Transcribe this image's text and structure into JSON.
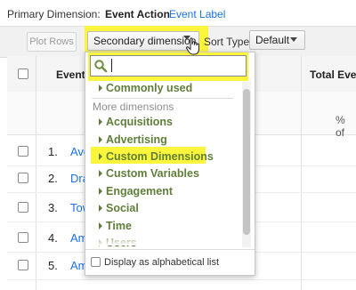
{
  "header": {
    "primary_label": "Primary Dimension:",
    "primary_active": "Event Action",
    "primary_other": "Event Label"
  },
  "toolbar": {
    "plot_rows": "Plot Rows",
    "secondary_dimension": "Secondary dimension",
    "sort_label": "Sort Type:",
    "sort_value": "Default"
  },
  "table": {
    "col_event": "Event A",
    "col_total": "Total Event",
    "percent_text": "% of",
    "rows": [
      {
        "num": "1.",
        "label": "Ave"
      },
      {
        "num": "2.",
        "label": "Dra"
      },
      {
        "num": "3.",
        "label": "Tow"
      },
      {
        "num": "4.",
        "label": "Am"
      },
      {
        "num": "5.",
        "label": "Am"
      }
    ]
  },
  "dropdown": {
    "search_value": "",
    "commonly_used": "Commonly used",
    "more_label": "More dimensions",
    "items": [
      "Acquisitions",
      "Advertising",
      "Custom Dimensions",
      "Custom Variables",
      "Engagement",
      "Social",
      "Time",
      "Users"
    ],
    "alphabetical": "Display as alphabetical list"
  },
  "colors": {
    "highlight": "#fbf53b",
    "link": "#1a73e8",
    "menu_green": "#5f7f3a"
  }
}
